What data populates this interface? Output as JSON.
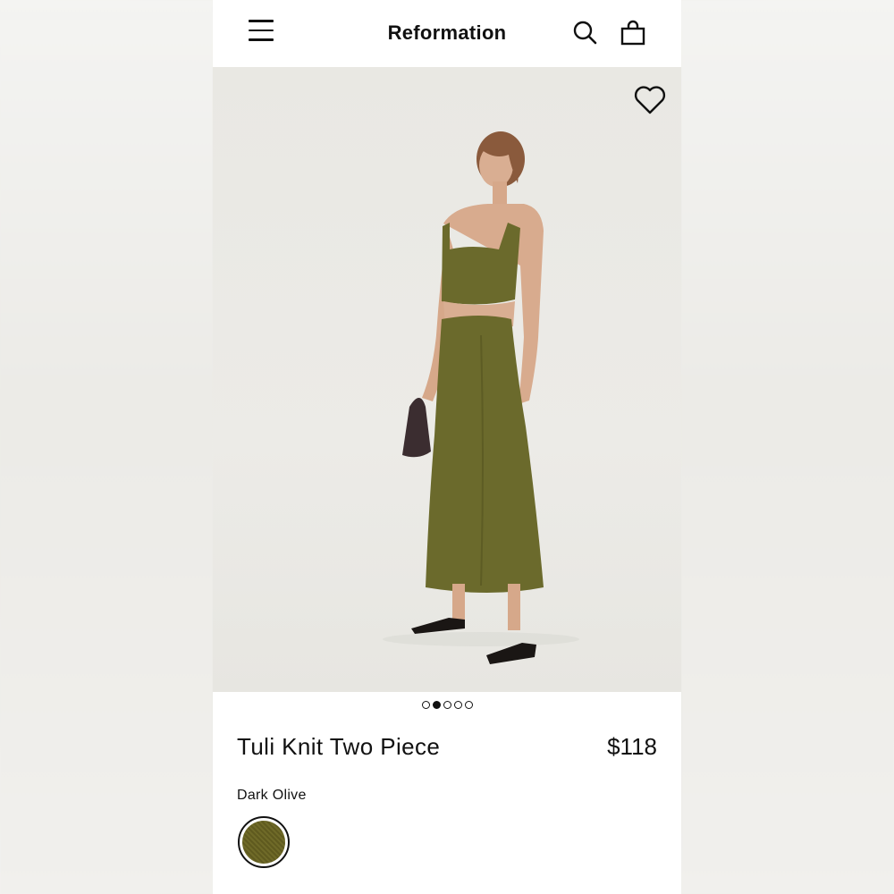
{
  "header": {
    "brand": "Reformation",
    "icons": [
      "menu-icon",
      "search-icon",
      "shopping-bag-icon"
    ]
  },
  "gallery": {
    "image_count": 5,
    "active_index": 1,
    "favorite_icon": "heart-icon"
  },
  "product": {
    "name": "Tuli Knit Two Piece",
    "price": "$118",
    "color_label": "Dark Olive",
    "swatch_color": "#625d22"
  },
  "colors": {
    "olive": "#6b6a2c",
    "text": "#111111",
    "photo_bg": "#ebeae6"
  }
}
